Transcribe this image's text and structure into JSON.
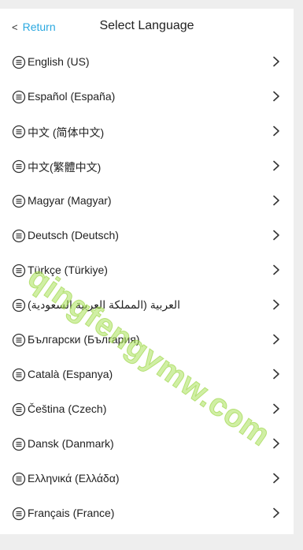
{
  "header": {
    "return_chevron": "<",
    "return_label": "Return",
    "title": "Select Language"
  },
  "languages": [
    {
      "label": "English (US)"
    },
    {
      "label": "Español (España)"
    },
    {
      "label": "中文 (简体中文)"
    },
    {
      "label": "中文(繁體中文)"
    },
    {
      "label": "Magyar (Magyar)"
    },
    {
      "label": "Deutsch (Deutsch)"
    },
    {
      "label": "Türkçe (Türkiye)"
    },
    {
      "label": "العربية (المملكة العربية السعودية)"
    },
    {
      "label": "Български (България)"
    },
    {
      "label": "Català (Espanya)"
    },
    {
      "label": "Čeština (Czech)"
    },
    {
      "label": "Dansk (Danmark)"
    },
    {
      "label": "Ελληνικά (Ελλάδα)"
    },
    {
      "label": "Français (France)"
    }
  ],
  "watermark": "qingfengymw.com",
  "icons": {
    "item_icon": "list-circle-icon",
    "arrow_icon": "chevron-right-icon"
  },
  "colors": {
    "accent": "#2aa8e0",
    "watermark": "#aae15a"
  }
}
